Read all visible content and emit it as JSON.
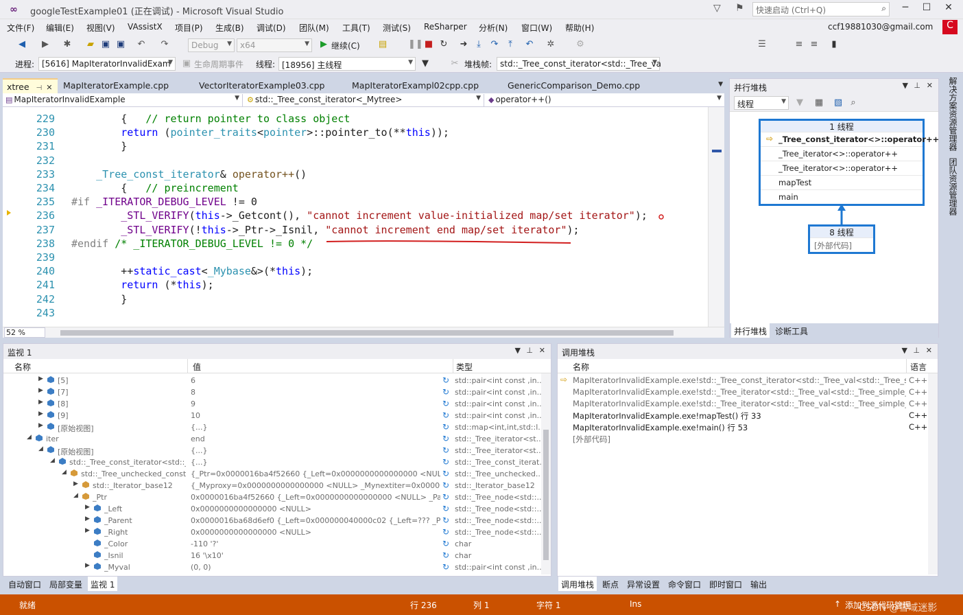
{
  "window": {
    "title": "googleTestExample01 (正在调试) - Microsoft Visual Studio",
    "quick_launch_placeholder": "快速启动 (Ctrl+Q)"
  },
  "menu": [
    "文件(F)",
    "编辑(E)",
    "视图(V)",
    "VAssistX",
    "项目(P)",
    "生成(B)",
    "调试(D)",
    "团队(M)",
    "工具(T)",
    "测试(S)",
    "ReSharper",
    "分析(N)",
    "窗口(W)",
    "帮助(H)"
  ],
  "account": {
    "email": "ccf19881030@gmail.com",
    "badge": "C"
  },
  "toolbar": {
    "config": "Debug",
    "platform": "x64",
    "continue_label": "继续(C)",
    "process_label": "进程:",
    "process_value": "[5616] MapIteratorInvalidExam",
    "lifecycle_label": "生命周期事件",
    "thread_label": "线程:",
    "thread_value": "[18956] 主线程",
    "stackframe_label": "堆栈帧:",
    "stackframe_value": "std::_Tree_const_iterator<std::_Tree_va"
  },
  "editor": {
    "tabs": [
      {
        "label": "xtree",
        "active": true
      },
      {
        "label": "MapIteratorExample.cpp"
      },
      {
        "label": "VectorIteratorExample03.cpp"
      },
      {
        "label": "MapIteratorExampl02cpp.cpp"
      },
      {
        "label": "GenericComparison_Demo.cpp"
      }
    ],
    "nav_project": "MapIteratorInvalidExample",
    "nav_scope": "std::_Tree_const_iterator<_Mytree>",
    "nav_member": "operator++()",
    "zoom": "52 %",
    "lines": [
      {
        "n": "229",
        "code": [
          [
            "",
            "        {   "
          ],
          [
            "cm",
            "// return pointer to class object"
          ]
        ]
      },
      {
        "n": "230",
        "code": [
          [
            "kw",
            "        return "
          ],
          [
            "",
            "("
          ],
          [
            "ty",
            "pointer_traits"
          ],
          [
            "",
            "<"
          ],
          [
            "ty",
            "pointer"
          ],
          [
            "",
            ">::pointer_to(**"
          ],
          [
            "kw",
            "this"
          ],
          [
            "",
            "));"
          ]
        ]
      },
      {
        "n": "231",
        "code": [
          [
            "",
            "        }"
          ]
        ]
      },
      {
        "n": "232",
        "code": [
          [
            "",
            ""
          ]
        ]
      },
      {
        "n": "233",
        "code": [
          [
            "ty",
            "    _Tree_const_iterator"
          ],
          [
            "",
            "& "
          ],
          [
            "fn",
            "operator++"
          ],
          [
            "",
            "()"
          ]
        ]
      },
      {
        "n": "234",
        "code": [
          [
            "",
            "        {   "
          ],
          [
            "cm",
            "// preincrement"
          ]
        ]
      },
      {
        "n": "235",
        "code": [
          [
            "pp",
            "#if "
          ],
          [
            "mc",
            "_ITERATOR_DEBUG_LEVEL"
          ],
          [
            "",
            " != 0"
          ]
        ]
      },
      {
        "n": "236",
        "code": [
          [
            "mc",
            "        _STL_VERIFY"
          ],
          [
            "",
            "("
          ],
          [
            "kw",
            "this"
          ],
          [
            "",
            "->_Getcont(), "
          ],
          [
            "st",
            "\"cannot increment value-initialized map/set iterator\""
          ],
          [
            "",
            ");"
          ]
        ]
      },
      {
        "n": "237",
        "code": [
          [
            "mc",
            "        _STL_VERIFY"
          ],
          [
            "",
            "(!"
          ],
          [
            "kw",
            "this"
          ],
          [
            "",
            "->_Ptr->_Isnil, "
          ],
          [
            "st",
            "\"cannot increment end map/set iterator\""
          ],
          [
            "",
            ");"
          ]
        ]
      },
      {
        "n": "238",
        "code": [
          [
            "pp",
            "#endif "
          ],
          [
            "cm",
            "/* _ITERATOR_DEBUG_LEVEL != 0 */"
          ]
        ]
      },
      {
        "n": "239",
        "code": [
          [
            "",
            ""
          ]
        ]
      },
      {
        "n": "240",
        "code": [
          [
            "",
            "        ++"
          ],
          [
            "kw",
            "static_cast"
          ],
          [
            "",
            "<"
          ],
          [
            "ty",
            "_Mybase"
          ],
          [
            "",
            "&>(*"
          ],
          [
            "kw",
            "this"
          ],
          [
            "",
            ");"
          ]
        ]
      },
      {
        "n": "241",
        "code": [
          [
            "kw",
            "        return "
          ],
          [
            "",
            "(*"
          ],
          [
            "kw",
            "this"
          ],
          [
            "",
            ");"
          ]
        ]
      },
      {
        "n": "242",
        "code": [
          [
            "",
            "        }"
          ]
        ]
      },
      {
        "n": "243",
        "code": [
          [
            "",
            ""
          ]
        ]
      }
    ]
  },
  "parallel_stacks": {
    "title": "并行堆栈",
    "view_combo": "线程",
    "box1": {
      "header": "1 线程",
      "frames": [
        "_Tree_const_iterator<>::operator++",
        "_Tree_iterator<>::operator++",
        "_Tree_iterator<>::operator++",
        "mapTest",
        "main"
      ]
    },
    "box2": {
      "header": "8 线程",
      "frames": [
        "[外部代码]"
      ]
    },
    "tabs": [
      "并行堆栈",
      "诊断工具"
    ]
  },
  "watch": {
    "title": "监视 1",
    "columns": [
      "名称",
      "值",
      "类型"
    ],
    "rows": [
      {
        "indent": 1,
        "exp": "▶",
        "name": "[5]",
        "value": "6",
        "type": "std::pair<int const ,in..."
      },
      {
        "indent": 1,
        "exp": "▶",
        "name": "[7]",
        "value": "8",
        "type": "std::pair<int const ,in..."
      },
      {
        "indent": 1,
        "exp": "▶",
        "name": "[8]",
        "value": "9",
        "type": "std::pair<int const ,in..."
      },
      {
        "indent": 1,
        "exp": "▶",
        "name": "[9]",
        "value": "10",
        "type": "std::pair<int const ,in..."
      },
      {
        "indent": 1,
        "exp": "▶",
        "name": "[原始视图]",
        "value": "{...}",
        "type": "std::map<int,int,std::l..."
      },
      {
        "indent": 0,
        "exp": "◢",
        "name": "iter",
        "value": "end",
        "type": "std::_Tree_iterator<st..."
      },
      {
        "indent": 1,
        "exp": "◢",
        "name": "[原始视图]",
        "value": "{...}",
        "type": "std::_Tree_iterator<st..."
      },
      {
        "indent": 2,
        "exp": "◢",
        "name": "std::_Tree_const_iterator<std::_Tre...",
        "value": "{...}",
        "type": "std::_Tree_const_iterat..."
      },
      {
        "indent": 3,
        "exp": "◢",
        "name": "std::_Tree_unchecked_const_it...",
        "value": "{_Ptr=0x0000016ba4f52660 {_Left=0x0000000000000000 <NULL> _Pa...",
        "type": "std::_Tree_unchecked..."
      },
      {
        "indent": 4,
        "exp": "▶",
        "name": "std::_Iterator_base12",
        "value": "{_Myproxy=0x0000000000000000 <NULL> _Mynextiter=0x00000000...",
        "type": "std::_Iterator_base12"
      },
      {
        "indent": 4,
        "exp": "◢",
        "name": "_Ptr",
        "value": "0x0000016ba4f52660 {_Left=0x0000000000000000 <NULL> _Parent=...",
        "type": "std::_Tree_node<std::..."
      },
      {
        "indent": 5,
        "exp": "▶",
        "name": "_Left",
        "value": "0x0000000000000000 <NULL>",
        "type": "std::_Tree_node<std::..."
      },
      {
        "indent": 5,
        "exp": "▶",
        "name": "_Parent",
        "value": "0x0000016ba68d6ef0 {_Left=0x000000040000c02 {_Left=??? _Parent...",
        "type": "std::_Tree_node<std::..."
      },
      {
        "indent": 5,
        "exp": "▶",
        "name": "_Right",
        "value": "0x0000000000000000 <NULL>",
        "type": "std::_Tree_node<std::..."
      },
      {
        "indent": 5,
        "exp": "",
        "name": "_Color",
        "value": "-110 '?'",
        "type": "char"
      },
      {
        "indent": 5,
        "exp": "",
        "name": "_Isnil",
        "value": "16 '\\x10'",
        "type": "char"
      },
      {
        "indent": 5,
        "exp": "▶",
        "name": "_Myval",
        "value": "(0, 0)",
        "type": "std::pair<int const ,in..."
      }
    ],
    "tabs": [
      "自动窗口",
      "局部变量",
      "监视 1"
    ]
  },
  "callstack": {
    "title": "调用堆栈",
    "columns": [
      "名称",
      "语言"
    ],
    "rows": [
      {
        "name": "MapIteratorInvalidExample.exe!std::_Tree_const_iterator<std::_Tree_val<std::_Tree_simple_t...",
        "lang": "C++",
        "current": true,
        "ext": true
      },
      {
        "name": "MapIteratorInvalidExample.exe!std::_Tree_iterator<std::_Tree_val<std::_Tree_simple_types<s...",
        "lang": "C++",
        "ext": true
      },
      {
        "name": "MapIteratorInvalidExample.exe!std::_Tree_iterator<std::_Tree_val<std::_Tree_simple_types<s...",
        "lang": "C++",
        "ext": true
      },
      {
        "name": "MapIteratorInvalidExample.exe!mapTest() 行 33",
        "lang": "C++"
      },
      {
        "name": "MapIteratorInvalidExample.exe!main() 行 53",
        "lang": "C++"
      },
      {
        "name": "[外部代码]",
        "lang": "",
        "ext": true
      }
    ],
    "tabs": [
      "调用堆栈",
      "断点",
      "异常设置",
      "命令窗口",
      "即时窗口",
      "输出"
    ]
  },
  "right_strip": [
    "解决方案资源管理器",
    "团队资源管理器"
  ],
  "status": {
    "state": "就绪",
    "line": "行 236",
    "col": "列 1",
    "char": "字符 1",
    "ins": "Ins",
    "source_control": "添加到源代码管理",
    "watermark": "CSDN @雪域迷影"
  },
  "colors": {
    "status_bar": "#ca5100",
    "stack_box_border": "#1e78d2",
    "active_tab": "#fffcdb"
  }
}
